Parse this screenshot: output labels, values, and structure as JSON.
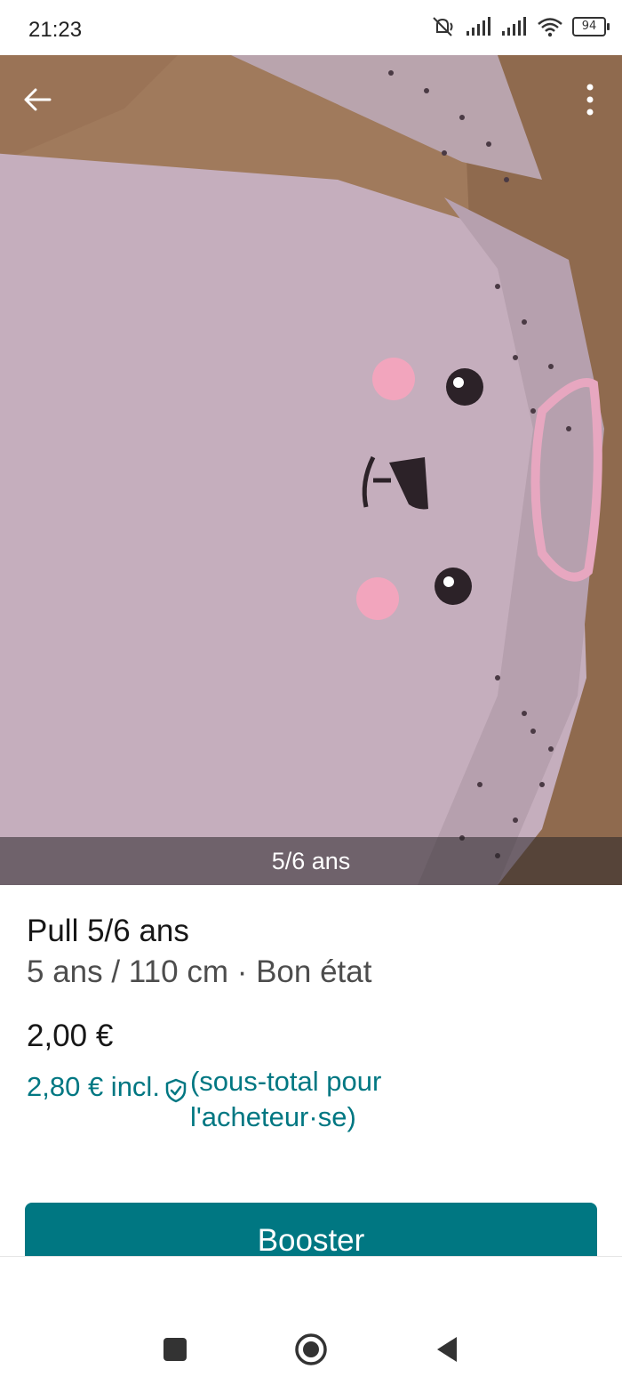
{
  "status_bar": {
    "time": "21:23",
    "battery": "94",
    "icons": [
      "mute-icon",
      "signal-icon",
      "signal-icon",
      "wifi-icon",
      "battery-icon"
    ]
  },
  "photo": {
    "caption": "5/6 ans",
    "icons": [
      "back-arrow-icon",
      "more-vertical-icon"
    ]
  },
  "item": {
    "title": "Pull 5/6 ans",
    "subtitle": "5 ans / 110 cm · Bon état",
    "price": "2,00 €",
    "price_incl": "2,80 € incl.",
    "price_note_line1": "(sous-total pour",
    "price_note_line2": "l'acheteur·se)"
  },
  "actions": {
    "booster_label": "Booster"
  },
  "colors": {
    "brand": "#007782"
  },
  "system_nav": [
    "recent-apps-icon",
    "home-icon",
    "back-icon"
  ]
}
